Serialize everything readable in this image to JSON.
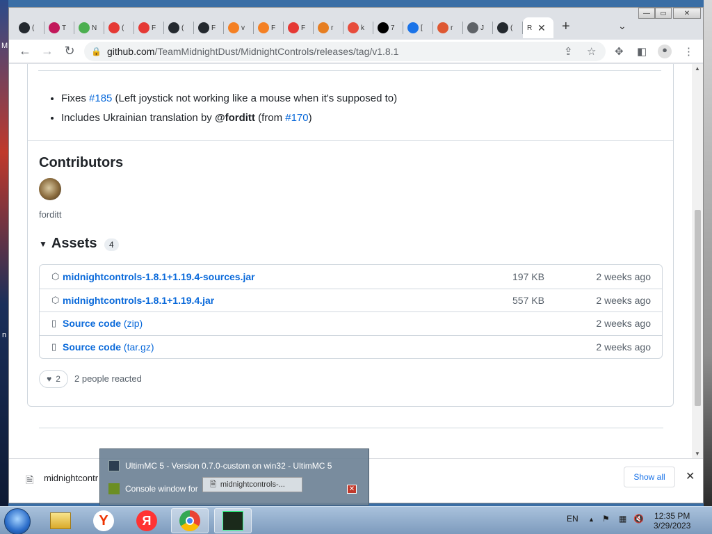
{
  "browser": {
    "tabs": [
      {
        "label": "(",
        "icon": "github-icon",
        "color": "#24292f"
      },
      {
        "label": "T",
        "icon": "arc-icon",
        "color": "#c2185b"
      },
      {
        "label": "N",
        "icon": "minecraft-icon",
        "color": "#4caf50"
      },
      {
        "label": "(",
        "icon": "opera-icon",
        "color": "#e53935"
      },
      {
        "label": "F",
        "icon": "opera-icon",
        "color": "#e53935"
      },
      {
        "label": "(",
        "icon": "github-icon",
        "color": "#24292f"
      },
      {
        "label": "F",
        "icon": "github-icon",
        "color": "#24292f"
      },
      {
        "label": "v",
        "icon": "stackoverflow-icon",
        "color": "#f48024"
      },
      {
        "label": "F",
        "icon": "stackoverflow-icon",
        "color": "#f48024"
      },
      {
        "label": "F",
        "icon": "apps-icon",
        "color": "#e53935"
      },
      {
        "label": "r",
        "icon": "gear-icon",
        "color": "#e67e22"
      },
      {
        "label": "k",
        "icon": "ask-icon",
        "color": "#e74c3c"
      },
      {
        "label": "7",
        "icon": "7zip-icon",
        "color": "#000000"
      },
      {
        "label": "[",
        "icon": "download-icon",
        "color": "#1a73e8"
      },
      {
        "label": "r",
        "icon": "duckduckgo-icon",
        "color": "#de5833"
      },
      {
        "label": "J",
        "icon": "globe-icon",
        "color": "#5f6368"
      },
      {
        "label": "(",
        "icon": "github-icon",
        "color": "#24292f"
      },
      {
        "label": "R",
        "icon": "",
        "color": "#ffffff"
      }
    ],
    "new_tab": "+",
    "tab_dropdown": "⌄",
    "window_controls": {
      "minimize": "—",
      "maximize": "▭",
      "close": "✕"
    },
    "url_host": "github.com",
    "url_path": "/TeamMidnightDust/MidnightControls/releases/tag/v1.8.1"
  },
  "release": {
    "bullets": [
      {
        "prefix": "Fixes ",
        "link": "#185",
        "suffix": " (Left joystick not working like a mouse when it's supposed to)"
      },
      {
        "prefix": "Includes Ukrainian translation by ",
        "user": "@forditt",
        "mid": " (from ",
        "link": "#170",
        "suffix": ")"
      }
    ],
    "contributors_heading": "Contributors",
    "contributor_name": "forditt",
    "assets_heading": "Assets",
    "assets_count": "4",
    "assets": [
      {
        "name": "midnightcontrols-1.8.1+1.19.4-sources.jar",
        "ext": "",
        "size": "197 KB",
        "date": "2 weeks ago",
        "icon": "package-icon"
      },
      {
        "name": "midnightcontrols-1.8.1+1.19.4.jar",
        "ext": "",
        "size": "557 KB",
        "date": "2 weeks ago",
        "icon": "package-icon"
      },
      {
        "name": "Source code",
        "ext": " (zip)",
        "size": "",
        "date": "2 weeks ago",
        "icon": "file-zip-icon"
      },
      {
        "name": "Source code",
        "ext": " (tar.gz)",
        "size": "",
        "date": "2 weeks ago",
        "icon": "file-zip-icon"
      }
    ],
    "reaction_count": "2",
    "reaction_text": "2 people reacted"
  },
  "download_bar": {
    "file_name": "midnightcontr",
    "show_all": "Show all"
  },
  "taskbar_preview": {
    "item1": "UltimMC 5 - Version 0.7.0-custom on win32 - UltimMC 5",
    "item2": "Console window for",
    "drag_label": "midnightcontrols-..."
  },
  "taskbar": {
    "language": "EN",
    "time": "12:35 PM",
    "date": "3/29/2023"
  },
  "desktop": {
    "edge_text_1": "M",
    "edge_text_2": "n"
  }
}
